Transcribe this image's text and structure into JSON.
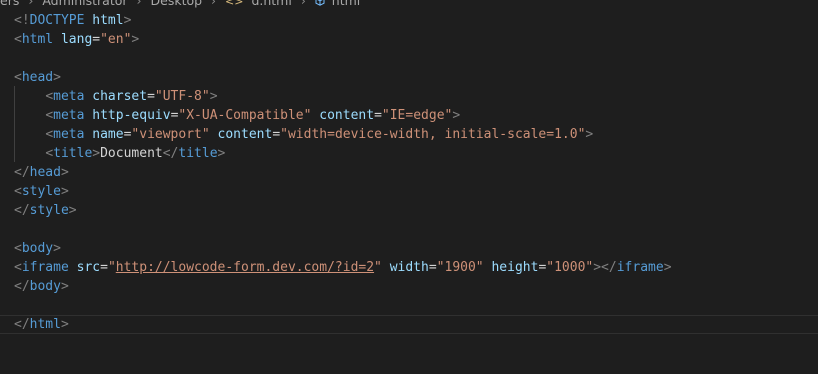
{
  "breadcrumb": {
    "items": [
      "ers",
      "Administrator",
      "Desktop",
      "d.html",
      "html"
    ],
    "file_icon": "html-file-icon",
    "symbol_icon": "cube-symbol-icon"
  },
  "code": {
    "lines": [
      [
        {
          "t": "tag",
          "v": "<!"
        },
        {
          "t": "name",
          "v": "DOCTYPE"
        },
        {
          "t": "text",
          "v": " "
        },
        {
          "t": "attr",
          "v": "html"
        },
        {
          "t": "tag",
          "v": ">"
        }
      ],
      [
        {
          "t": "tag",
          "v": "<"
        },
        {
          "t": "name",
          "v": "html"
        },
        {
          "t": "text",
          "v": " "
        },
        {
          "t": "attr",
          "v": "lang"
        },
        {
          "t": "text",
          "v": "="
        },
        {
          "t": "str",
          "v": "\"en\""
        },
        {
          "t": "tag",
          "v": ">"
        }
      ],
      [],
      [
        {
          "t": "tag",
          "v": "<"
        },
        {
          "t": "name",
          "v": "head"
        },
        {
          "t": "tag",
          "v": ">"
        }
      ],
      [
        {
          "t": "text",
          "v": "    "
        },
        {
          "t": "tag",
          "v": "<"
        },
        {
          "t": "name",
          "v": "meta"
        },
        {
          "t": "text",
          "v": " "
        },
        {
          "t": "attr",
          "v": "charset"
        },
        {
          "t": "text",
          "v": "="
        },
        {
          "t": "str",
          "v": "\"UTF-8\""
        },
        {
          "t": "tag",
          "v": ">"
        }
      ],
      [
        {
          "t": "text",
          "v": "    "
        },
        {
          "t": "tag",
          "v": "<"
        },
        {
          "t": "name",
          "v": "meta"
        },
        {
          "t": "text",
          "v": " "
        },
        {
          "t": "attr",
          "v": "http-equiv"
        },
        {
          "t": "text",
          "v": "="
        },
        {
          "t": "str",
          "v": "\"X-UA-Compatible\""
        },
        {
          "t": "text",
          "v": " "
        },
        {
          "t": "attr",
          "v": "content"
        },
        {
          "t": "text",
          "v": "="
        },
        {
          "t": "str",
          "v": "\"IE=edge\""
        },
        {
          "t": "tag",
          "v": ">"
        }
      ],
      [
        {
          "t": "text",
          "v": "    "
        },
        {
          "t": "tag",
          "v": "<"
        },
        {
          "t": "name",
          "v": "meta"
        },
        {
          "t": "text",
          "v": " "
        },
        {
          "t": "attr",
          "v": "name"
        },
        {
          "t": "text",
          "v": "="
        },
        {
          "t": "str",
          "v": "\"viewport\""
        },
        {
          "t": "text",
          "v": " "
        },
        {
          "t": "attr",
          "v": "content"
        },
        {
          "t": "text",
          "v": "="
        },
        {
          "t": "str",
          "v": "\"width=device-width, initial-scale=1.0\""
        },
        {
          "t": "tag",
          "v": ">"
        }
      ],
      [
        {
          "t": "text",
          "v": "    "
        },
        {
          "t": "tag",
          "v": "<"
        },
        {
          "t": "name",
          "v": "title"
        },
        {
          "t": "tag",
          "v": ">"
        },
        {
          "t": "text",
          "v": "Document"
        },
        {
          "t": "tag",
          "v": "</"
        },
        {
          "t": "name",
          "v": "title"
        },
        {
          "t": "tag",
          "v": ">"
        }
      ],
      [
        {
          "t": "tag",
          "v": "</"
        },
        {
          "t": "name",
          "v": "head"
        },
        {
          "t": "tag",
          "v": ">"
        }
      ],
      [
        {
          "t": "tag",
          "v": "<"
        },
        {
          "t": "name",
          "v": "style"
        },
        {
          "t": "tag",
          "v": ">"
        }
      ],
      [
        {
          "t": "tag",
          "v": "</"
        },
        {
          "t": "name",
          "v": "style"
        },
        {
          "t": "tag",
          "v": ">"
        }
      ],
      [],
      [
        {
          "t": "tag",
          "v": "<"
        },
        {
          "t": "name",
          "v": "body"
        },
        {
          "t": "tag",
          "v": ">"
        }
      ],
      [
        {
          "t": "tag",
          "v": "<"
        },
        {
          "t": "name",
          "v": "iframe"
        },
        {
          "t": "text",
          "v": " "
        },
        {
          "t": "attr",
          "v": "src"
        },
        {
          "t": "text",
          "v": "="
        },
        {
          "t": "str",
          "v": "\""
        },
        {
          "t": "link",
          "v": "http://lowcode-form.dev.com/?id=2"
        },
        {
          "t": "str",
          "v": "\""
        },
        {
          "t": "text",
          "v": " "
        },
        {
          "t": "attr",
          "v": "width"
        },
        {
          "t": "text",
          "v": "="
        },
        {
          "t": "str",
          "v": "\"1900\""
        },
        {
          "t": "text",
          "v": " "
        },
        {
          "t": "attr",
          "v": "height"
        },
        {
          "t": "text",
          "v": "="
        },
        {
          "t": "str",
          "v": "\"1000\""
        },
        {
          "t": "tag",
          "v": "></"
        },
        {
          "t": "name",
          "v": "iframe"
        },
        {
          "t": "tag",
          "v": ">"
        }
      ],
      [
        {
          "t": "tag",
          "v": "</"
        },
        {
          "t": "name",
          "v": "body"
        },
        {
          "t": "tag",
          "v": ">"
        }
      ],
      [],
      [
        {
          "t": "tag",
          "v": "</"
        },
        {
          "t": "name",
          "v": "html"
        },
        {
          "t": "tag",
          "v": ">"
        }
      ]
    ],
    "active_line_index": 16
  }
}
